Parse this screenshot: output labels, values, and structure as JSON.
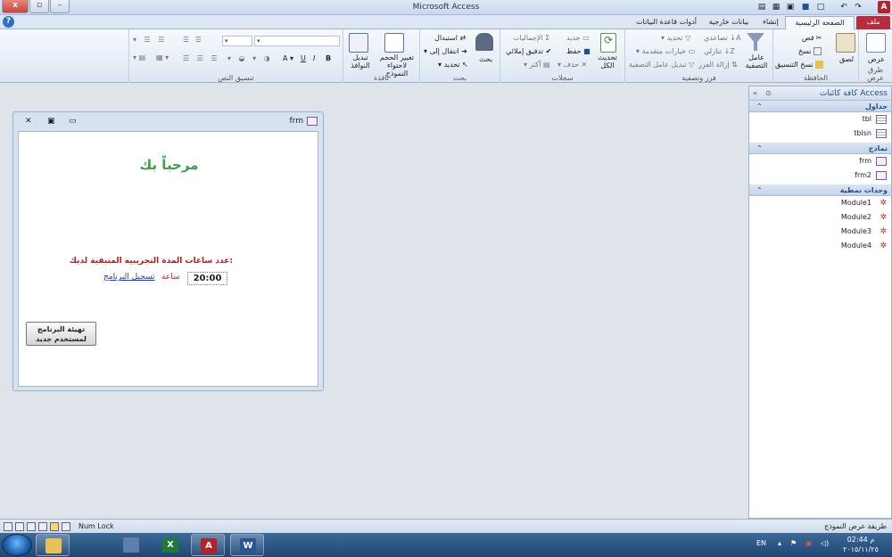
{
  "window": {
    "title": "Microsoft Access",
    "close_glyph": "x",
    "max_glyph": "▫",
    "min_glyph": "–"
  },
  "qat": {
    "icons": [
      "undo-icon",
      "redo-icon",
      "save-icon",
      "open-icon",
      "print-icon"
    ]
  },
  "tabs": {
    "file": "ملف",
    "home": "الصفحة الرئيسية",
    "create": "إنشاء",
    "external": "بيانات خارجية",
    "dbtools": "أدوات قاعدة البيانات"
  },
  "ribbon": {
    "views": {
      "label": "طرق عرض",
      "view": "عرض"
    },
    "clipboard": {
      "label": "الحافظة",
      "paste": "لصق",
      "cut": "قص",
      "copy": "نسخ",
      "format_painter": "نسخ التنسيق"
    },
    "sort_filter": {
      "label": "فرز وتصفية",
      "filter": "عامل التصفية",
      "ascending": "تصاعدي",
      "descending": "تنازلي",
      "remove_sort": "إزالة الفرز",
      "selection": "تحديد",
      "advanced": "خيارات متقدمة",
      "toggle_filter": "تبديل عامل التصفية"
    },
    "records": {
      "label": "سجلات",
      "refresh_all": "تحديث الكل",
      "new": "جديد",
      "save": "حفظ",
      "delete": "حذف",
      "totals": "الإجماليات",
      "spelling": "تدقيق إملائي",
      "more": "أكثر"
    },
    "find": {
      "label": "بحث",
      "find": "بحث",
      "replace": "استبدال",
      "goto": "انتقال إلى",
      "select": "تحديد"
    },
    "window": {
      "label": "نافذة",
      "size_to_fit": "تغيير الحجم لاحتواء النموذج",
      "switch_windows": "تبديل النوافذ"
    },
    "text_formatting": {
      "label": "تنسيق النص",
      "bold": "B",
      "italic": "I",
      "underline": "U",
      "font_color": "A"
    }
  },
  "nav": {
    "header": "كافة كائنات Access",
    "groups": [
      {
        "label": "جداول",
        "items": [
          "tbl",
          "tblsn"
        ]
      },
      {
        "label": "نماذج",
        "items": [
          "frm",
          "frm2"
        ]
      },
      {
        "label": "وحدات نمطية",
        "items": [
          "Module1",
          "Module2",
          "Module3",
          "Module4"
        ]
      }
    ]
  },
  "form": {
    "title": "frm",
    "welcome": "مرحباً بك",
    "remaining_label": "عدد ساعات المدة التجريبية المتبقية لديك:",
    "hours_value": "20:00",
    "hour_word": "ساعة",
    "register_link": "تسجيل البرنامج",
    "init_button": "تهيئة البرنامج\nلمستخدم جديد"
  },
  "status": {
    "left": "طريقة عرض النموذج",
    "num_lock": "Num Lock"
  },
  "taskbar": {
    "lang": "EN",
    "time": "02:44 م",
    "date": "٢٠١٥/١١/٢٥"
  },
  "colors": {
    "file_tab": "#b82d3b",
    "welcome": "#3aa14a",
    "label_red": "#b01f1f",
    "link_blue": "#1a3dc4"
  }
}
